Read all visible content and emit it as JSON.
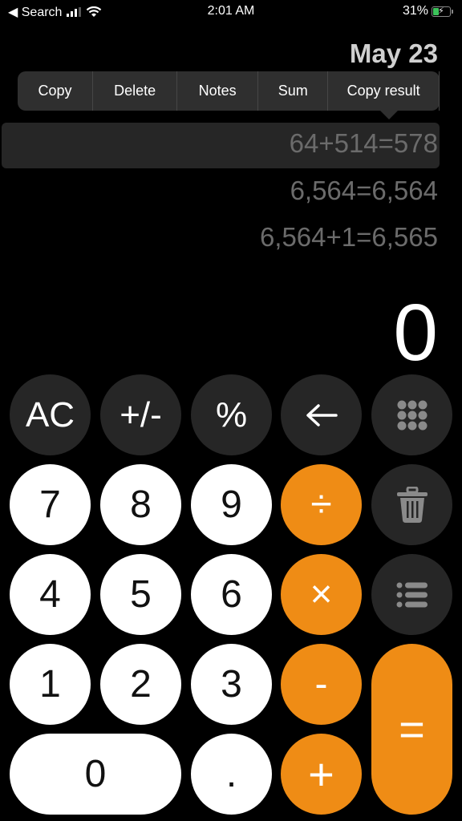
{
  "status_bar": {
    "back_label": "◀ Search",
    "time": "2:01 AM",
    "battery_percent": "31%",
    "battery_level": 0.31,
    "charging": true,
    "signal_bars": 3,
    "signal_bars_total": 4
  },
  "history": {
    "date": "May 23",
    "context_menu": [
      "Copy",
      "Delete",
      "Notes",
      "Sum",
      "Copy result"
    ],
    "entries": [
      {
        "expression": "64+514=578",
        "selected": true
      },
      {
        "expression": "6,564=6,564",
        "selected": false
      },
      {
        "expression": "6,564+1=6,565",
        "selected": false
      }
    ]
  },
  "display": {
    "value": "0"
  },
  "keypad": {
    "ac": "AC",
    "plus_minus": "+/-",
    "percent": "%",
    "backspace": "←",
    "k7": "7",
    "k8": "8",
    "k9": "9",
    "k4": "4",
    "k5": "5",
    "k6": "6",
    "k1": "1",
    "k2": "2",
    "k3": "3",
    "k0": "0",
    "decimal": ".",
    "divide": "÷",
    "multiply": "×",
    "minus": "-",
    "plus": "+",
    "equals": "="
  },
  "colors": {
    "operator": "#ef8c15",
    "function": "#262626",
    "digit": "#ffffff"
  }
}
